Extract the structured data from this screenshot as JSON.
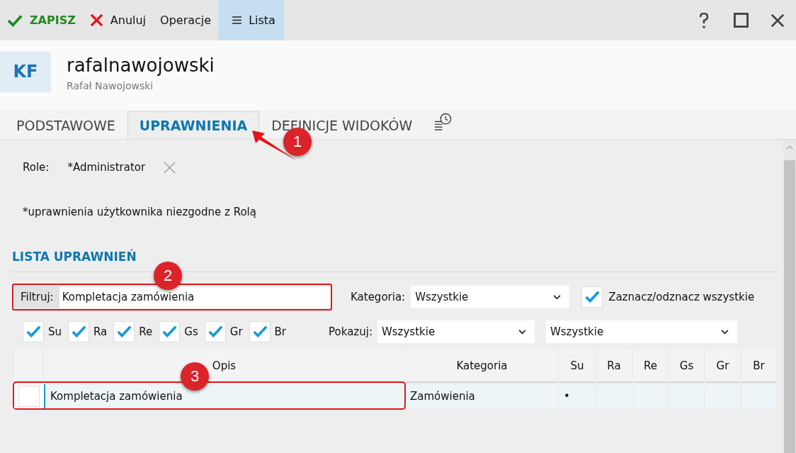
{
  "toolbar": [
    {
      "kind": "save",
      "label": "ZAPISZ",
      "selected": false
    },
    {
      "kind": "cancel",
      "label": "Anuluj",
      "selected": false
    },
    {
      "kind": "plain",
      "label": "Operacje",
      "selected": false
    },
    {
      "kind": "list",
      "label": "Lista",
      "selected": true
    }
  ],
  "header": {
    "initials": "KF",
    "title": "rafalnawojowski",
    "subtitle": "Rafał Nawojowski"
  },
  "tabs": [
    {
      "label": "PODSTAWOWE",
      "selected": false
    },
    {
      "label": "UPRAWNIENIA",
      "selected": true
    },
    {
      "label": "DEFINICJE WIDOKÓW",
      "selected": false
    }
  ],
  "role": {
    "label": "Role:",
    "value": "*Administrator"
  },
  "note": "*uprawnienia użytkownika niezgodne z Rolą",
  "section_title": "LISTA UPRAWNIEŃ",
  "filter": {
    "label": "Filtruj:",
    "value": "Kompletacja zamówienia",
    "highlighted": true
  },
  "category": {
    "label": "Kategoria:",
    "value": "Wszystkie"
  },
  "select_all": {
    "label": "Zaznacz/odznacz wszystkie",
    "checked": true
  },
  "column_checks": [
    {
      "label": "Su",
      "checked": true
    },
    {
      "label": "Ra",
      "checked": true
    },
    {
      "label": "Re",
      "checked": true
    },
    {
      "label": "Gs",
      "checked": true
    },
    {
      "label": "Gr",
      "checked": true
    },
    {
      "label": "Br",
      "checked": true
    }
  ],
  "show": {
    "label": "Pokazuj:",
    "value": "Wszystkie",
    "value_2": "Wszystkie"
  },
  "table": {
    "columns": [
      "Opis",
      "Kategoria",
      "Su",
      "Ra",
      "Re",
      "Gs",
      "Gr",
      "Br"
    ],
    "rows": [
      {
        "checked": false,
        "highlighted": true,
        "opis": "Kompletacja zamówienia",
        "kategoria": "Zamówienia",
        "marks": [
          "•"
        ]
      }
    ]
  },
  "annotations": [
    "1",
    "2",
    "3"
  ]
}
